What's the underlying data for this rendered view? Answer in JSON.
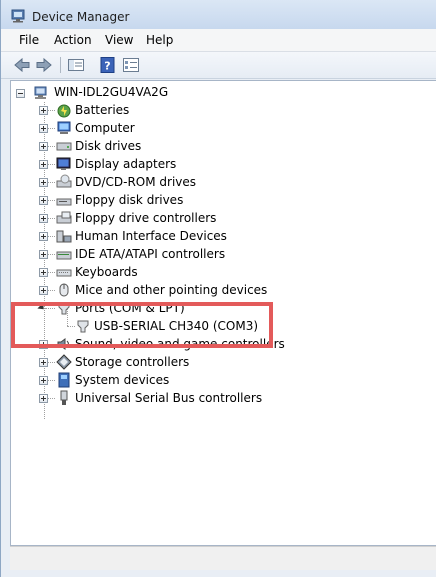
{
  "window": {
    "title": "Device Manager"
  },
  "menu": [
    "File",
    "Action",
    "View",
    "Help"
  ],
  "tree": {
    "root": "WIN-IDL2GU4VA2G",
    "categories": [
      {
        "label": "Batteries",
        "icon": "battery-icon"
      },
      {
        "label": "Computer",
        "icon": "computer-icon"
      },
      {
        "label": "Disk drives",
        "icon": "disk-drive-icon"
      },
      {
        "label": "Display adapters",
        "icon": "display-adapter-icon"
      },
      {
        "label": "DVD/CD-ROM drives",
        "icon": "dvd-drive-icon"
      },
      {
        "label": "Floppy disk drives",
        "icon": "floppy-disk-icon"
      },
      {
        "label": "Floppy drive controllers",
        "icon": "floppy-controller-icon"
      },
      {
        "label": "Human Interface Devices",
        "icon": "hid-icon"
      },
      {
        "label": "IDE ATA/ATAPI controllers",
        "icon": "ide-controller-icon"
      },
      {
        "label": "Keyboards",
        "icon": "keyboard-icon"
      },
      {
        "label": "Mice and other pointing devices",
        "icon": "mouse-icon"
      },
      {
        "label": "Ports (COM & LPT)",
        "icon": "port-icon",
        "expanded": true,
        "children": [
          {
            "label": "USB-SERIAL CH340 (COM3)",
            "icon": "serial-port-icon"
          }
        ]
      },
      {
        "label": "Sound, video and game controllers",
        "icon": "sound-icon"
      },
      {
        "label": "Storage controllers",
        "icon": "storage-icon"
      },
      {
        "label": "System devices",
        "icon": "system-device-icon"
      },
      {
        "label": "Universal Serial Bus controllers",
        "icon": "usb-icon"
      }
    ]
  },
  "highlight_color": "#e35a5a"
}
